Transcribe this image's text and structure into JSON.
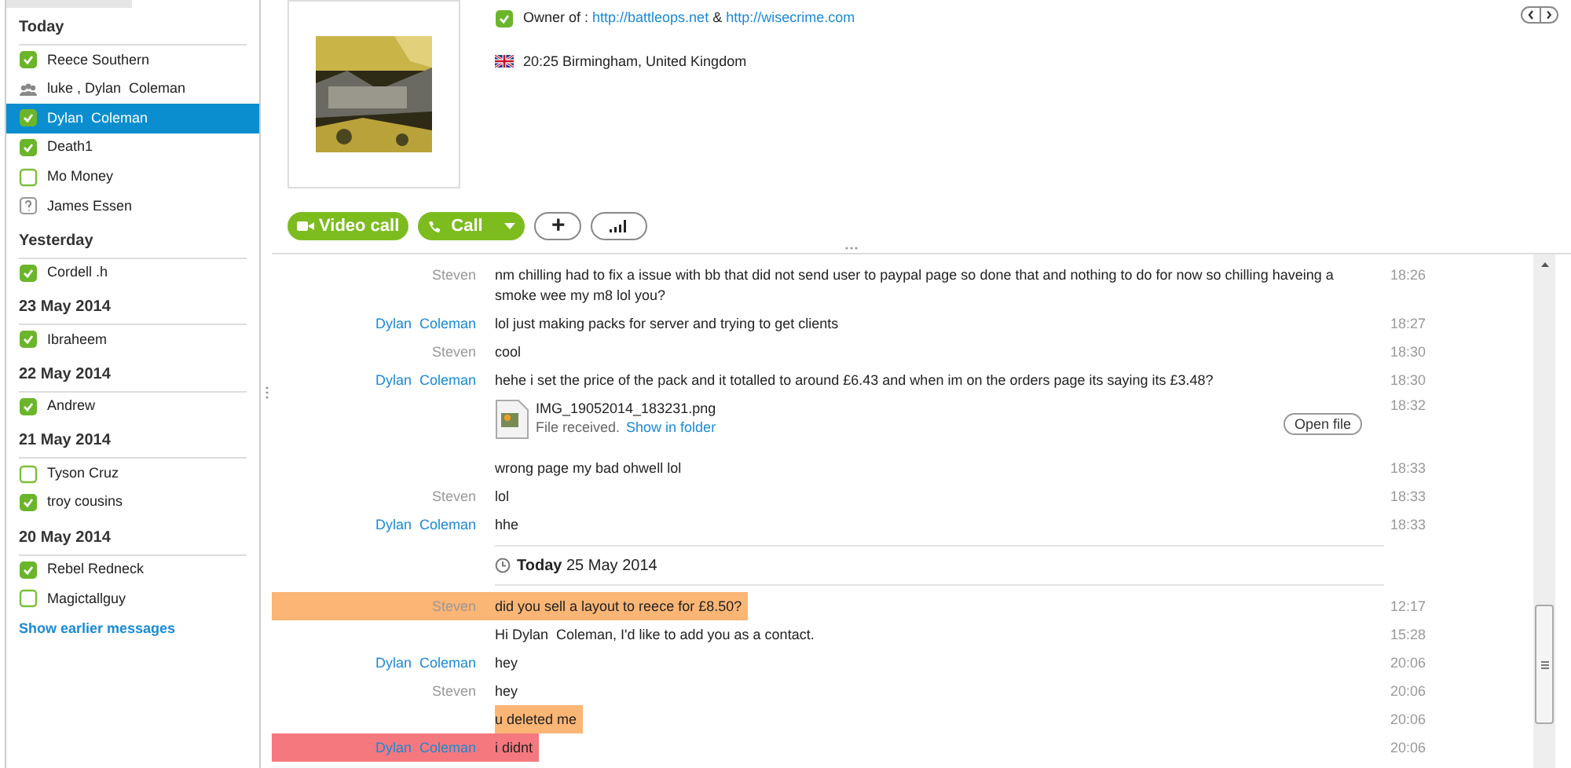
{
  "sidebar": {
    "groups": [
      {
        "heading": "Today",
        "contacts": [
          {
            "name": "Reece Southern",
            "kind": "online",
            "selected": false
          },
          {
            "name": "luke , Dylan  Coleman",
            "kind": "group",
            "selected": false
          },
          {
            "name": "Dylan  Coleman",
            "kind": "online",
            "selected": true
          },
          {
            "name": "Death1",
            "kind": "online",
            "selected": false
          },
          {
            "name": "Mo Money",
            "kind": "offline",
            "selected": false
          },
          {
            "name": "James Essen",
            "kind": "unknown",
            "selected": false
          }
        ]
      },
      {
        "heading": "Yesterday",
        "contacts": [
          {
            "name": "Cordell .h",
            "kind": "online",
            "selected": false
          }
        ]
      },
      {
        "heading": "23 May 2014",
        "contacts": [
          {
            "name": "Ibraheem",
            "kind": "online",
            "selected": false
          }
        ]
      },
      {
        "heading": "22 May 2014",
        "contacts": [
          {
            "name": "Andrew",
            "kind": "online",
            "selected": false
          }
        ]
      },
      {
        "heading": "21 May 2014",
        "contacts": [
          {
            "name": "Tyson Cruz",
            "kind": "offline",
            "selected": false
          },
          {
            "name": "troy cousins",
            "kind": "online",
            "selected": false
          }
        ]
      },
      {
        "heading": "20 May 2014",
        "contacts": [
          {
            "name": "Rebel Redneck",
            "kind": "online",
            "selected": false
          },
          {
            "name": "Magictallguy",
            "kind": "offline",
            "selected": false
          }
        ]
      }
    ],
    "show_more": "Show earlier messages"
  },
  "profile": {
    "mood_prefix": "Owner of : ",
    "mood_links": [
      "http://battleops.net",
      "http://wisecrime.com"
    ],
    "mood_joiner": " & ",
    "location": "20:25 Birmingham, United Kingdom"
  },
  "actions": {
    "video_call": "Video call",
    "call": "Call",
    "add": "+"
  },
  "messages": [
    {
      "kind": "text",
      "sender": "Steven",
      "own": false,
      "text": "nm chilling had to fix a issue with bb that did not send user to paypal page so done that and nothing to do for now so chilling haveing a smoke wee my m8 lol you?",
      "time": "18:26"
    },
    {
      "kind": "text",
      "sender": "Dylan  Coleman",
      "own": true,
      "text": "lol just making packs for server and trying to get clients",
      "time": "18:27"
    },
    {
      "kind": "text",
      "sender": "Steven",
      "own": false,
      "text": "cool",
      "time": "18:30"
    },
    {
      "kind": "text",
      "sender": "Dylan  Coleman",
      "own": true,
      "text": "hehe i set the price of the pack and it totalled to around £6.43 and when im on the orders page its saying its £3.48?",
      "time": "18:30"
    },
    {
      "kind": "file",
      "filename": "IMG_19052014_183231.png",
      "status": "File received.",
      "link": "Show in folder",
      "button": "Open file",
      "time": "18:32"
    },
    {
      "kind": "text",
      "text": "wrong page my bad ohwell lol",
      "time": "18:33"
    },
    {
      "kind": "text",
      "sender": "Steven",
      "own": false,
      "text": "lol",
      "time": "18:33"
    },
    {
      "kind": "text",
      "sender": "Dylan  Coleman",
      "own": true,
      "text": "hhe",
      "time": "18:33"
    },
    {
      "kind": "date",
      "day": "Today",
      "date": "25 May 2014"
    },
    {
      "kind": "text",
      "sender": "Steven",
      "own": false,
      "text": "did you sell a layout to reece for £8.50?",
      "time": "12:17",
      "color": "#fbb575",
      "highlight_name": true
    },
    {
      "kind": "text",
      "text": "Hi Dylan  Coleman, I'd like to add you as a contact.",
      "time": "15:28"
    },
    {
      "kind": "text",
      "sender": "Dylan  Coleman",
      "own": true,
      "text": "hey",
      "time": "20:06"
    },
    {
      "kind": "text",
      "sender": "Steven",
      "own": false,
      "text": "hey",
      "time": "20:06"
    },
    {
      "kind": "text",
      "text": "u deleted me",
      "time": "20:06",
      "color": "#fbb575",
      "highlight_name": false
    },
    {
      "kind": "text",
      "sender": "Dylan  Coleman",
      "own": true,
      "text": "i didnt",
      "time": "20:06",
      "color": "#f5787e",
      "highlight_name": true
    }
  ]
}
